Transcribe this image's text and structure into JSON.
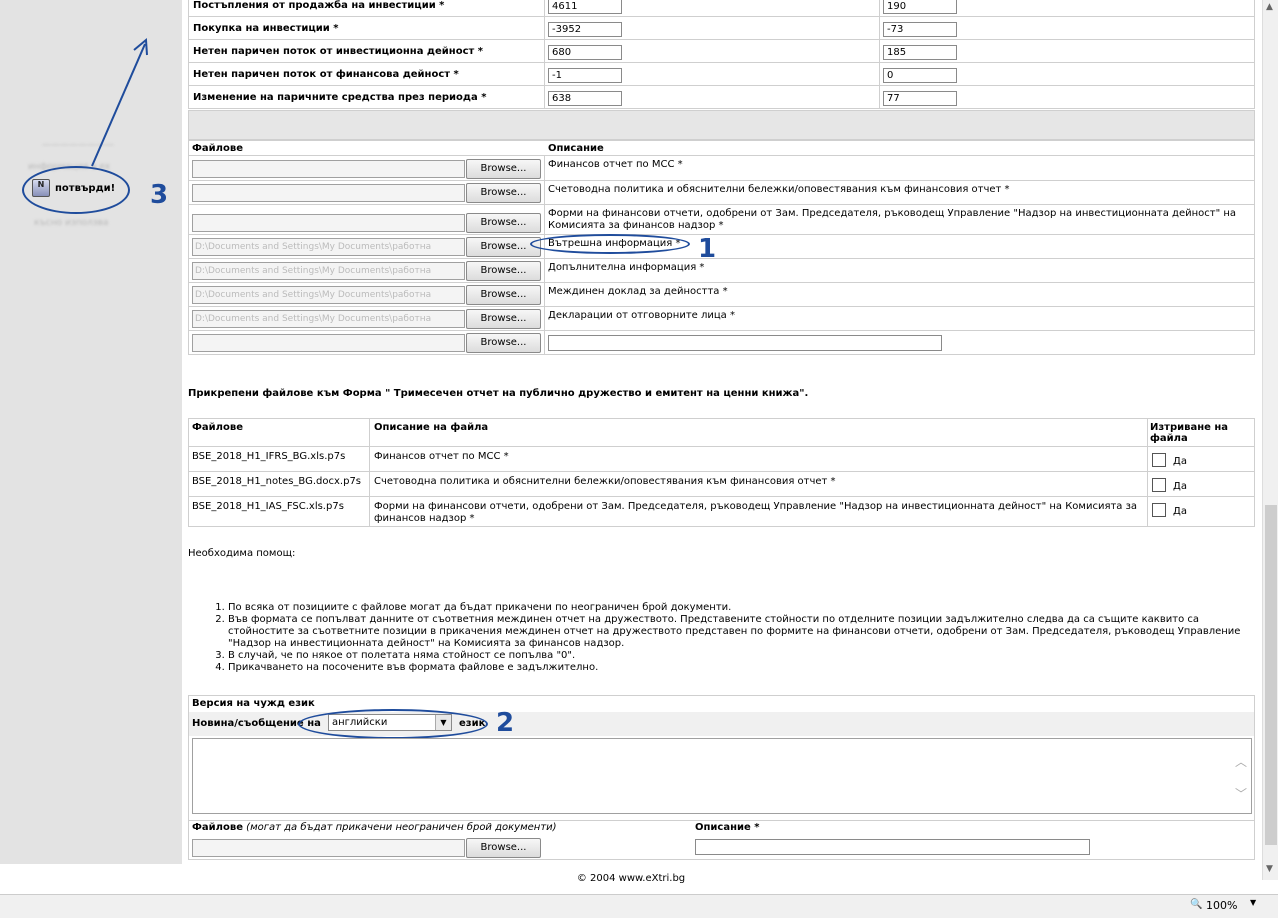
{
  "sidebar": {
    "blur1": "————————",
    "blur2": "информация в ex",
    "blur3": "късно използва",
    "confirm_label": "потвърди!",
    "confirm_icon_glyph": "N"
  },
  "annotations": {
    "n1": "1",
    "n2": "2",
    "n3": "3"
  },
  "cashflow": [
    {
      "label": "Постъпления от продажба на инвестиции *",
      "v1": "4611",
      "v2": "190"
    },
    {
      "label": "Покупка на инвестиции *",
      "v1": "-3952",
      "v2": "-73"
    },
    {
      "label": "Нетен паричен поток от инвестиционна дейност *",
      "v1": "680",
      "v2": "185"
    },
    {
      "label": "Нетен паричен поток от финансова дейност *",
      "v1": "-1",
      "v2": "0"
    },
    {
      "label": "Изменение на паричните средства през периода *",
      "v1": "638",
      "v2": "77"
    }
  ],
  "files_table": {
    "col_files": "Файлове",
    "col_desc": "Описание",
    "browse": "Browse...",
    "path": "D:\\Documents and Settings\\My Documents\\работна",
    "rows": [
      "Финансов отчет по МСС *",
      "Счетоводна политика и обяснителни бележки/оповестявания към финансовия отчет *",
      "Форми на финансови отчети, одобрени от Зам. Председателя, ръководещ Управление \"Надзор на инвестиционната дейност\" на Комисията за финансов надзор *",
      "Вътрешна информация *",
      "Допълнителна информация *",
      "Междинен доклад за дейността *",
      "Декларации от отговорните лица *"
    ]
  },
  "attached": {
    "title": "Прикрепени файлове към Форма \" Тримесечен отчет на публично дружество и емитент на ценни книжа\".",
    "col_files": "Файлове",
    "col_desc": "Описание на файла",
    "col_del": "Изтриване на файла",
    "yes": "Да",
    "rows": [
      {
        "file": "BSE_2018_H1_IFRS_BG.xls.p7s",
        "desc": "Финансов отчет по МСС *"
      },
      {
        "file": "BSE_2018_H1_notes_BG.docx.p7s",
        "desc": "Счетоводна политика и обяснителни бележки/оповестявания към финансовия отчет *"
      },
      {
        "file": "BSE_2018_H1_IAS_FSC.xls.p7s",
        "desc": "Форми на финансови отчети, одобрени от Зам. Председателя, ръководещ Управление \"Надзор на инвестиционната дейност\" на Комисията за финансов надзор *"
      }
    ]
  },
  "help": {
    "title": "Необходима помощ:",
    "items": [
      "По всяка от позициите с файлове могат да бъдат прикачени по неограничен брой документи.",
      "Във формата се попълват данните от съответния междинен отчет на дружеството. Представените стойности по отделните позиции задължително следва да са същите каквито са стойностите за съответните позиции в прикачения междинен отчет на дружеството представен по формите на финансови отчети, одобрени от Зам. Председателя, ръководещ Управление \"Надзор на инвестиционната дейност\" на Комисията за финансов надзор.",
      "В случай, че по някое от полетата няма стойност се попълва \"0\".",
      "Прикачването на посочените във формата файлове е задължително."
    ]
  },
  "foreign": {
    "title": "Версия на чужд език",
    "news_prefix": "Новина/съобщение на",
    "lang": "английски",
    "news_suffix": "език",
    "files_label": "Файлове",
    "files_note": "(могат да бъдат прикачени неограничен брой документи)",
    "desc_label": "Описание *",
    "browse": "Browse..."
  },
  "footer": "© 2004 www.eXtri.bg",
  "status": {
    "zoom": "100%"
  }
}
